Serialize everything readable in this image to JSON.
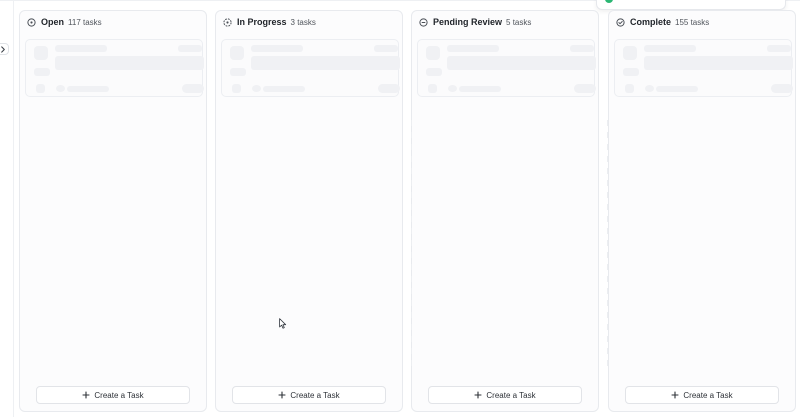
{
  "board": {
    "columns": [
      {
        "title": "Open",
        "count": "117 tasks",
        "create_label": "Create a Task"
      },
      {
        "title": "In Progress",
        "count": "3 tasks",
        "create_label": "Create a Task"
      },
      {
        "title": "Pending Review",
        "count": "5 tasks",
        "create_label": "Create a Task"
      },
      {
        "title": "Complete",
        "count": "155 tasks",
        "create_label": "Create a Task"
      }
    ]
  },
  "icons": {
    "status": "status-circle-icon",
    "plus": "plus-icon",
    "collapse": "chevron-right-icon",
    "toast": "success-dot-icon",
    "cursor": "mouse-cursor-icon"
  },
  "colors": {
    "accent_success": "#2bb673",
    "border": "#e8eaee",
    "skeleton": "#f0f1f4"
  }
}
